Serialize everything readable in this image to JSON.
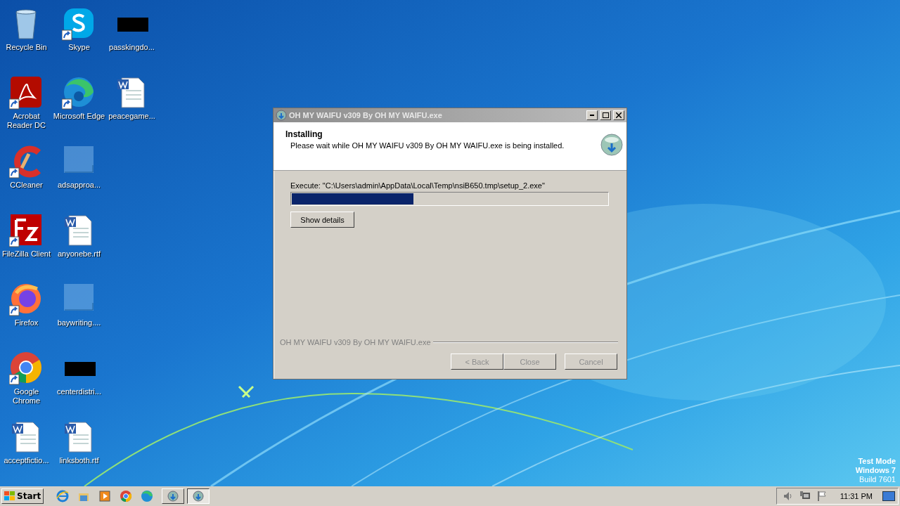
{
  "desktop_icons": [
    {
      "label": "Recycle Bin",
      "kind": "recycle",
      "shortcut": false
    },
    {
      "label": "Acrobat Reader DC",
      "kind": "acrobat",
      "shortcut": true
    },
    {
      "label": "CCleaner",
      "kind": "ccleaner",
      "shortcut": true
    },
    {
      "label": "FileZilla Client",
      "kind": "filezilla",
      "shortcut": true
    },
    {
      "label": "Firefox",
      "kind": "firefox",
      "shortcut": true
    },
    {
      "label": "Google Chrome",
      "kind": "chrome",
      "shortcut": true
    },
    {
      "label": "acceptfictio...",
      "kind": "word",
      "shortcut": false
    },
    {
      "label": "Skype",
      "kind": "skype",
      "shortcut": true
    },
    {
      "label": "Microsoft Edge",
      "kind": "edge",
      "shortcut": true
    },
    {
      "label": "adsapproa...",
      "kind": "blank",
      "shortcut": false
    },
    {
      "label": "anyonebe.rtf",
      "kind": "word",
      "shortcut": false
    },
    {
      "label": "baywriting....",
      "kind": "blank",
      "shortcut": false
    },
    {
      "label": "centerdistri...",
      "kind": "black",
      "shortcut": false
    },
    {
      "label": "linksboth.rtf",
      "kind": "word",
      "shortcut": false
    },
    {
      "label": "passkingdo...",
      "kind": "black",
      "shortcut": false
    },
    {
      "label": "peacegame...",
      "kind": "word",
      "shortcut": false
    }
  ],
  "window": {
    "title": "OH MY WAIFU v309 By OH MY WAIFU.exe",
    "header": {
      "title": "Installing",
      "subtitle": "Please wait while OH MY WAIFU v309 By OH MY WAIFU.exe is being installed."
    },
    "status": "Execute: \"C:\\Users\\admin\\AppData\\Local\\Temp\\nsiB650.tmp\\setup_2.exe\"",
    "progress": {
      "level": 0.385
    },
    "details_button": {
      "label": "Show details",
      "disabled": false
    },
    "branding": "OH MY WAIFU v309 By OH MY WAIFU.exe",
    "buttons": [
      {
        "label": "< Back",
        "disabled": true
      },
      {
        "label": "Close",
        "disabled": true
      },
      {
        "label": "Cancel",
        "disabled": true
      }
    ]
  },
  "taskbar": {
    "start": "Start",
    "quick_launch": [
      {
        "kind": "ie"
      },
      {
        "kind": "explorer"
      },
      {
        "kind": "media"
      },
      {
        "kind": "chrome"
      },
      {
        "kind": "edge"
      }
    ],
    "tasks": [
      {
        "kind": "installer",
        "selected": false
      },
      {
        "kind": "installer",
        "selected": true
      }
    ],
    "tray": {
      "clock": "11:31 PM"
    }
  },
  "watermark": [
    "Test Mode",
    "Windows 7",
    "Build 7601"
  ]
}
